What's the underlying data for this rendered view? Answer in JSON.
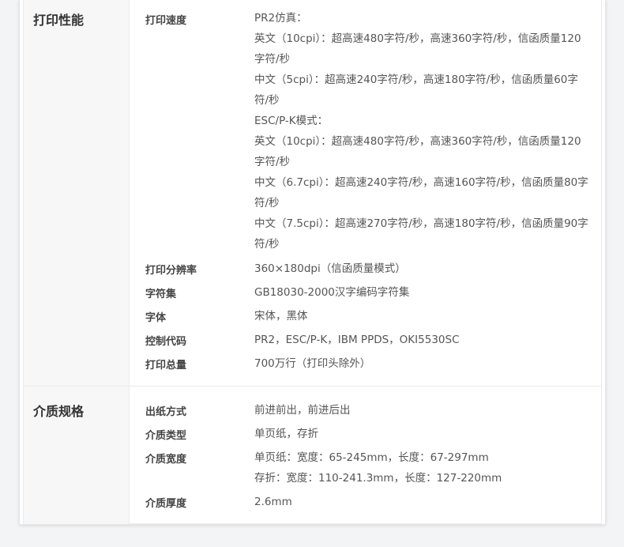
{
  "sections": [
    {
      "title": "打印性能",
      "rows": [
        {
          "key": "打印速度",
          "lines": [
            "PR2仿真：",
            "英文（10cpi）：超高速480字符/秒，高速360字符/秒，信函质量120",
            "字符/秒",
            "中文（5cpi）：超高速240字符/秒，高速180字符/秒，信函质量60字",
            "符/秒",
            "ESC/P-K模式：",
            "英文（10cpi）：超高速480字符/秒，高速360字符/秒，信函质量120",
            "字符/秒",
            "中文（6.7cpi）：超高速240字符/秒，高速160字符/秒，信函质量80字",
            "符/秒",
            "中文（7.5cpi）：超高速270字符/秒，高速180字符/秒，信函质量90字",
            "符/秒"
          ]
        },
        {
          "key": "打印分辨率",
          "lines": [
            "360×180dpi（信函质量模式）"
          ]
        },
        {
          "key": "字符集",
          "lines": [
            "GB18030-2000汉字编码字符集"
          ]
        },
        {
          "key": "字体",
          "lines": [
            "宋体，黑体"
          ]
        },
        {
          "key": "控制代码",
          "lines": [
            "PR2，ESC/P-K，IBM PPDS，OKI5530SC"
          ]
        },
        {
          "key": "打印总量",
          "lines": [
            "700万行（打印头除外）"
          ]
        }
      ]
    },
    {
      "title": "介质规格",
      "rows": [
        {
          "key": "出纸方式",
          "lines": [
            "前进前出，前进后出"
          ]
        },
        {
          "key": "介质类型",
          "lines": [
            "单页纸，存折"
          ]
        },
        {
          "key": "介质宽度",
          "lines": [
            "单页纸：宽度：65-245mm，长度：67-297mm",
            "存折：宽度：110-241.3mm，长度：127-220mm"
          ]
        },
        {
          "key": "介质厚度",
          "lines": [
            "2.6mm"
          ]
        }
      ]
    }
  ]
}
